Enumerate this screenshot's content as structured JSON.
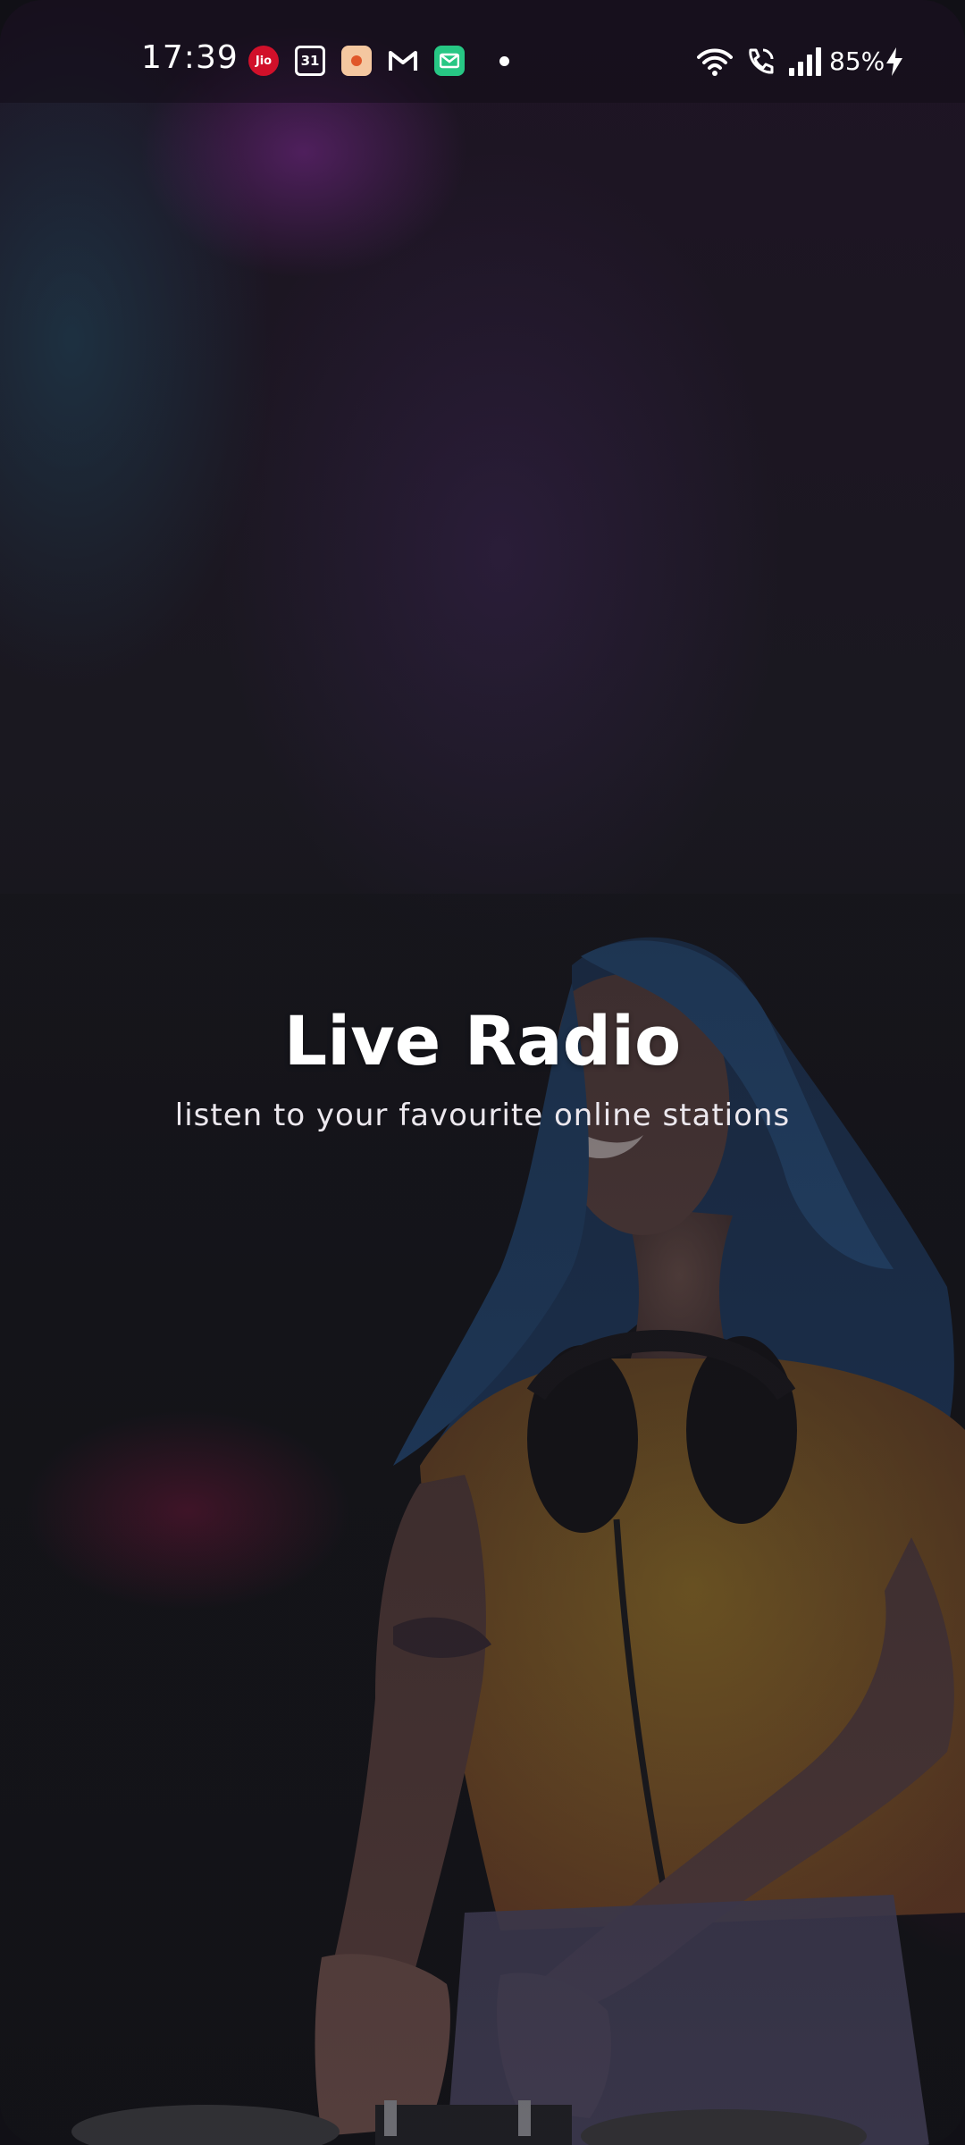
{
  "status_bar": {
    "time": "17:39",
    "notifications": [
      "jio-icon",
      "calendar-icon",
      "tb-icon",
      "gmail-icon",
      "email-icon"
    ],
    "calendar_day": "31",
    "jio_label": "Jio",
    "battery_text": "85%"
  },
  "splash": {
    "title": "Live Radio",
    "subtitle": "listen to your favourite online stations"
  },
  "colors": {
    "background": "#121216",
    "text": "#ffffff",
    "hair": "#2b5f9a",
    "shirt": "#d8a23a"
  }
}
